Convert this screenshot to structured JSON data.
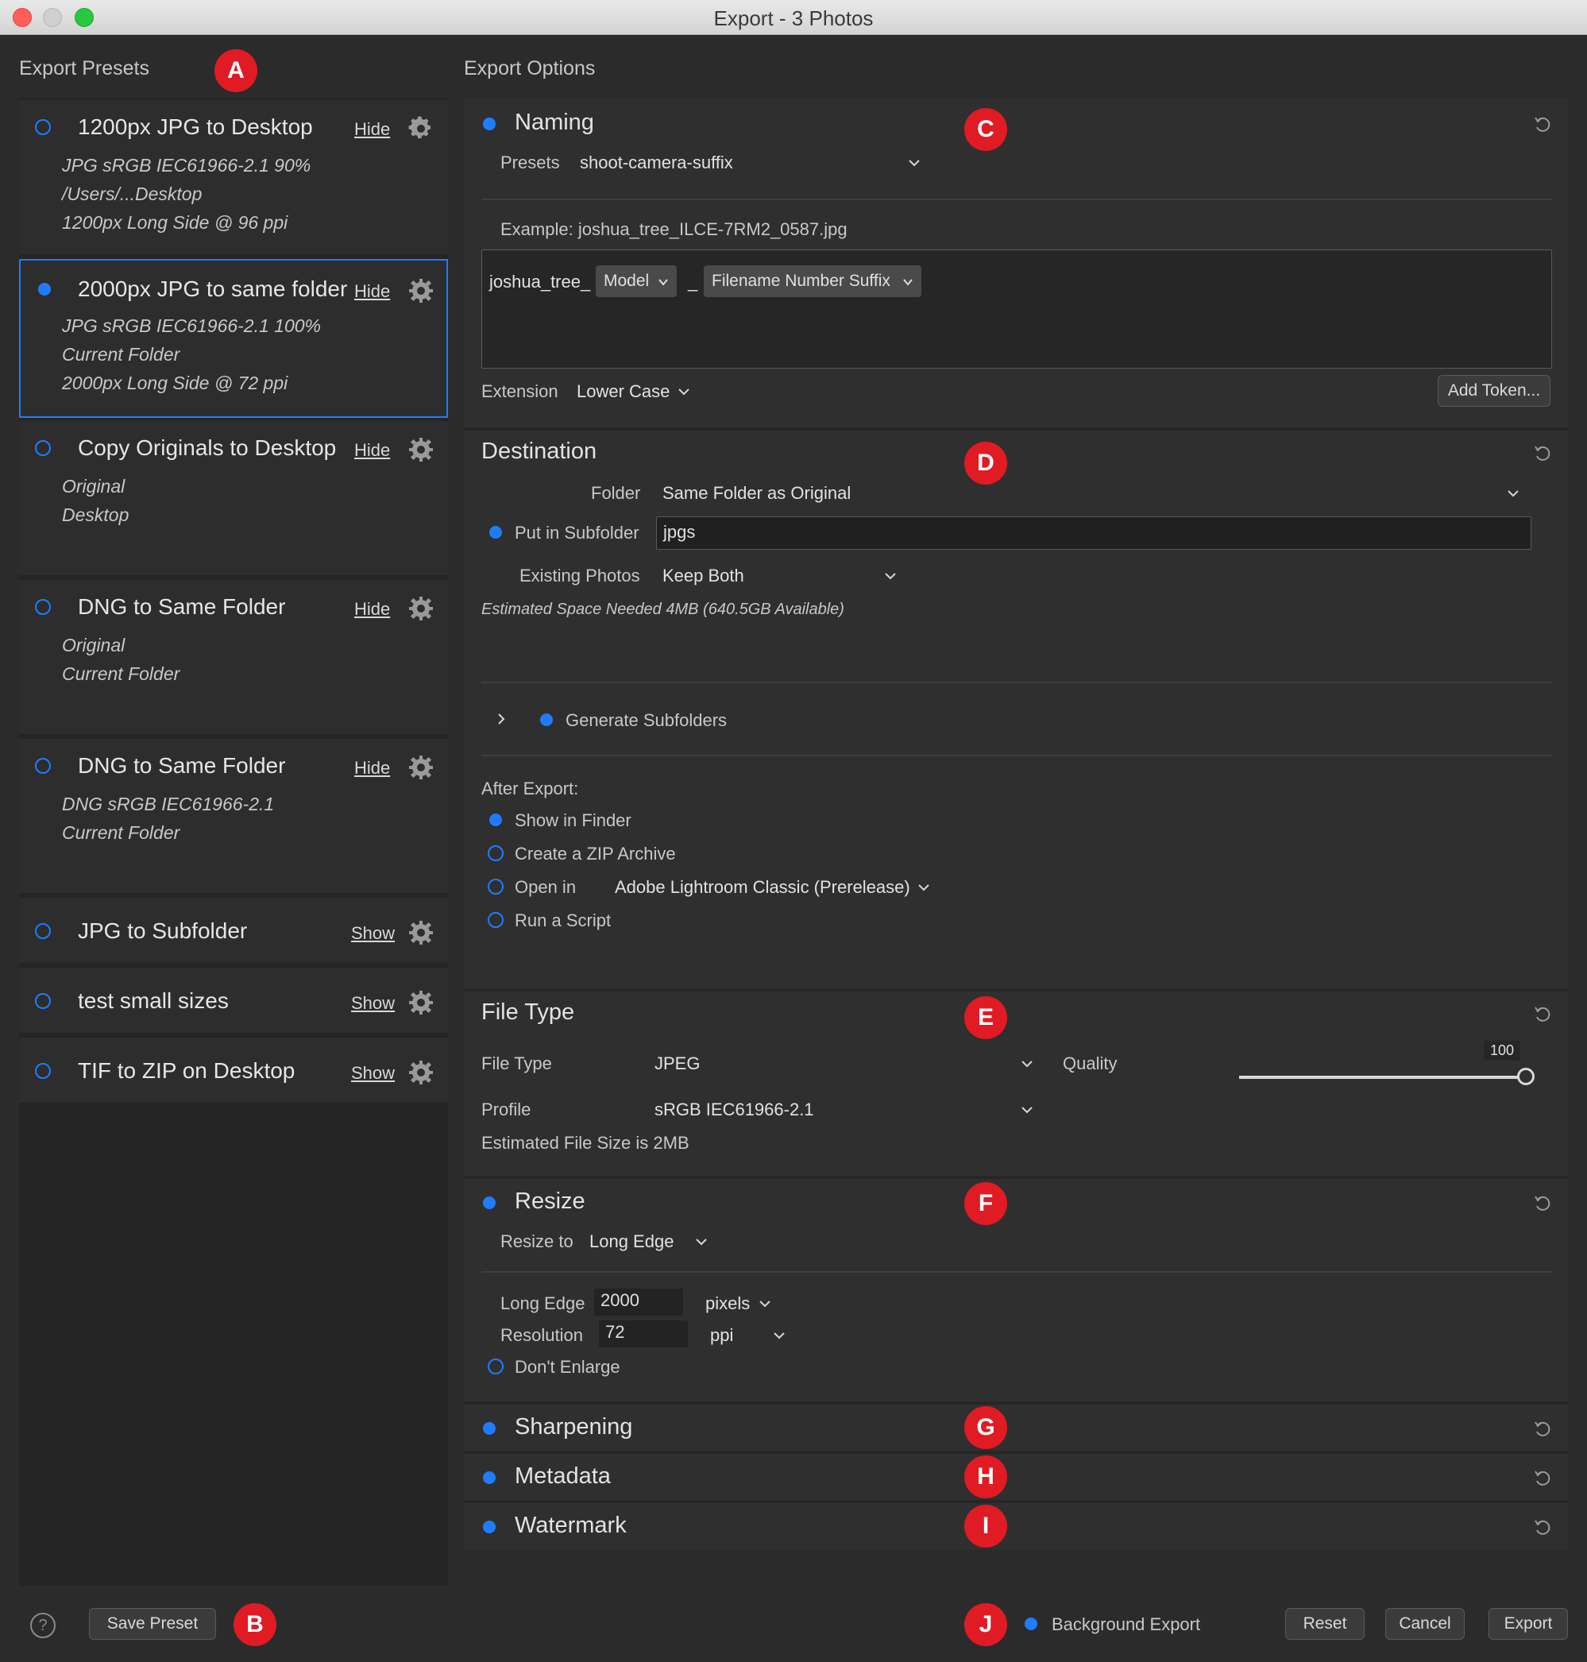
{
  "window": {
    "title": "Export - 3 Photos"
  },
  "left": {
    "title": "Export Presets",
    "badge": "A",
    "presets": [
      {
        "name": "1200px JPG to Desktop",
        "action": "Hide",
        "lines": [
          "JPG  sRGB IEC61966-2.1  90%",
          "/Users/...Desktop",
          "1200px Long Side @ 96 ppi"
        ],
        "selected": false
      },
      {
        "name": "2000px JPG to same folder",
        "action": "Hide",
        "lines": [
          "JPG  sRGB IEC61966-2.1  100%",
          "Current Folder",
          "2000px Long Side @ 72 ppi"
        ],
        "selected": true
      },
      {
        "name": "Copy Originals to Desktop",
        "action": "Hide",
        "lines": [
          "Original",
          "Desktop"
        ],
        "selected": false
      },
      {
        "name": "DNG to Same Folder",
        "action": "Hide",
        "lines": [
          "Original",
          "Current Folder"
        ],
        "selected": false
      },
      {
        "name": "DNG to Same Folder",
        "action": "Hide",
        "lines": [
          "DNG  sRGB IEC61966-2.1",
          "Current Folder"
        ],
        "selected": false
      },
      {
        "name": "JPG to Subfolder",
        "action": "Show",
        "lines": [],
        "selected": false
      },
      {
        "name": "test small sizes",
        "action": "Show",
        "lines": [],
        "selected": false
      },
      {
        "name": "TIF to ZIP on Desktop",
        "action": "Show",
        "lines": [],
        "selected": false
      }
    ],
    "save_preset": "Save Preset",
    "badge_b": "B",
    "help": "?"
  },
  "right": {
    "title": "Export Options",
    "naming": {
      "title": "Naming",
      "badge": "C",
      "presets_label": "Presets",
      "presets_value": "shoot-camera-suffix",
      "example": "Example: joshua_tree_ILCE-7RM2_0587.jpg",
      "tokens": {
        "prefix": "joshua_tree_",
        "model": "Model",
        "sep": "_",
        "suffix": "Filename Number Suffix"
      },
      "extension_label": "Extension",
      "extension_value": "Lower Case",
      "add_token": "Add Token..."
    },
    "destination": {
      "title": "Destination",
      "badge": "D",
      "folder_label": "Folder",
      "folder_value": "Same Folder as Original",
      "subfolder_label": "Put in Subfolder",
      "subfolder_value": "jpgs",
      "existing_label": "Existing Photos",
      "existing_value": "Keep Both",
      "space": "Estimated Space Needed 4MB (640.5GB Available)",
      "generate": "Generate Subfolders",
      "after_label": "After Export:",
      "after_options": [
        "Show in Finder",
        "Create a ZIP Archive",
        "Open in",
        "Run a Script"
      ],
      "after_selected": 0,
      "open_in_app": "Adobe Lightroom Classic (Prerelease)"
    },
    "file_type": {
      "title": "File Type",
      "badge": "E",
      "type_label": "File Type",
      "type_value": "JPEG",
      "quality_label": "Quality",
      "quality_value": "100",
      "quality_fraction": 1.0,
      "profile_label": "Profile",
      "profile_value": "sRGB IEC61966-2.1",
      "size": "Estimated File Size is 2MB"
    },
    "resize": {
      "title": "Resize",
      "badge": "F",
      "resize_to_label": "Resize to",
      "resize_to_value": "Long Edge",
      "long_edge_label": "Long Edge",
      "long_edge_value": "2000",
      "long_edge_unit": "pixels",
      "resolution_label": "Resolution",
      "resolution_value": "72",
      "resolution_unit": "ppi",
      "dont_enlarge": "Don't Enlarge"
    },
    "sharpening": {
      "title": "Sharpening",
      "badge": "G"
    },
    "metadata": {
      "title": "Metadata",
      "badge": "H"
    },
    "watermark": {
      "title": "Watermark",
      "badge": "I"
    }
  },
  "footer": {
    "badge": "J",
    "background_export": "Background Export",
    "reset": "Reset",
    "cancel": "Cancel",
    "export": "Export"
  },
  "colors": {
    "accent": "#1f7cff",
    "badge": "#e01b24"
  }
}
